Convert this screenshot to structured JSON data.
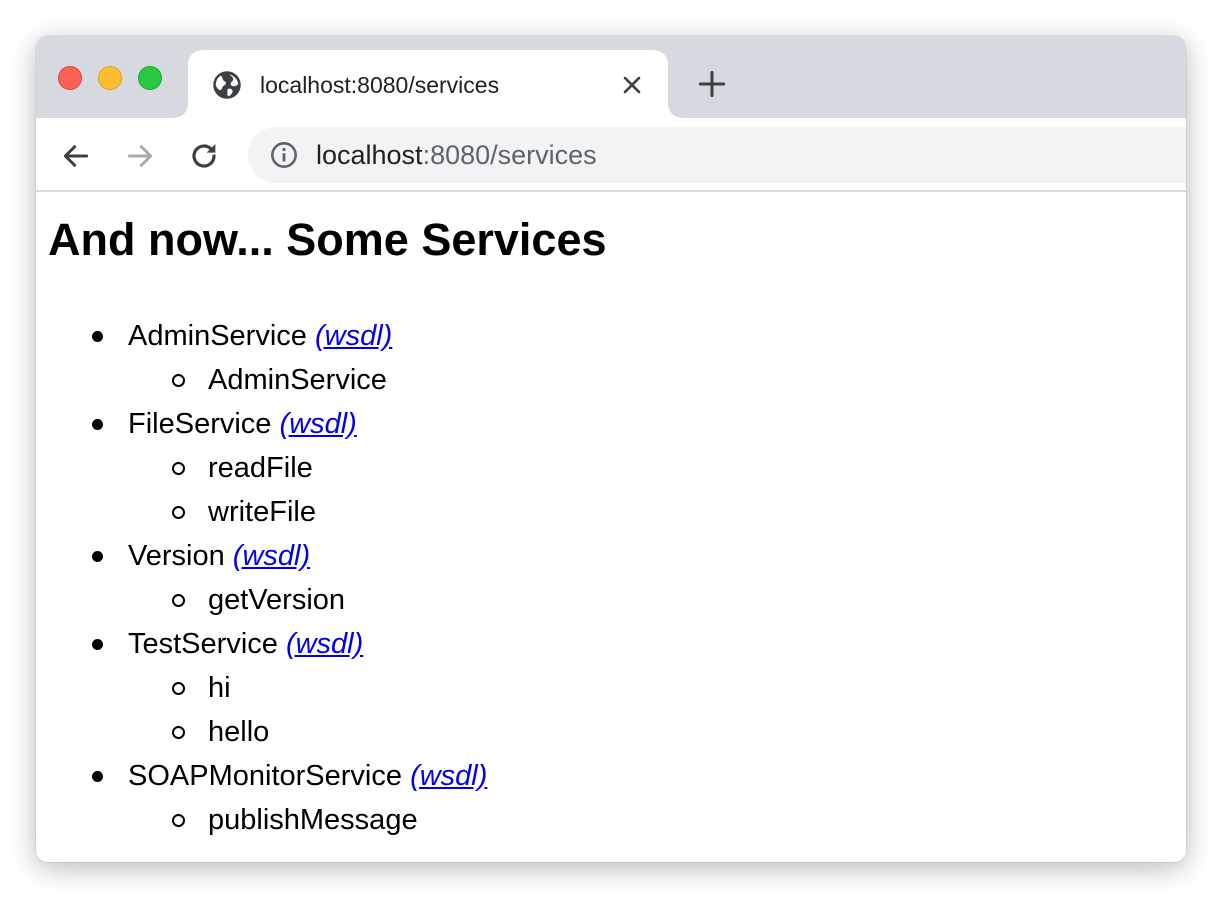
{
  "browser": {
    "tab_title": "localhost:8080/services",
    "url_host": "localhost",
    "url_rest": ":8080/services",
    "icons": {
      "tab_favicon": "globe-icon",
      "tab_close": "close-icon",
      "new_tab": "plus-icon",
      "back": "arrow-left-icon",
      "forward": "arrow-right-icon",
      "reload": "reload-icon",
      "site_info": "info-icon"
    }
  },
  "page": {
    "title": "And now... Some Services",
    "link_color": "#0000ee",
    "services": [
      {
        "name": "AdminService",
        "wsdl_label": "(wsdl)",
        "operations": [
          "AdminService"
        ]
      },
      {
        "name": "FileService",
        "wsdl_label": "(wsdl)",
        "operations": [
          "readFile",
          "writeFile"
        ]
      },
      {
        "name": "Version",
        "wsdl_label": "(wsdl)",
        "operations": [
          "getVersion"
        ]
      },
      {
        "name": "TestService",
        "wsdl_label": "(wsdl)",
        "operations": [
          "hi",
          "hello"
        ]
      },
      {
        "name": "SOAPMonitorService",
        "wsdl_label": "(wsdl)",
        "operations": [
          "publishMessage"
        ]
      }
    ]
  }
}
